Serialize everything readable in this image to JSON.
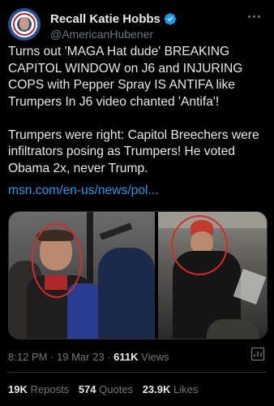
{
  "account": {
    "display_name": "Recall Katie Hobbs",
    "handle": "@AmericanHubener",
    "verified": true,
    "verified_color": "#1d9bf0"
  },
  "tweet": {
    "text": "Turns out 'MAGA Hat dude' BREAKING CAPITOL WINDOW on J6 and INJURING COPS with Pepper Spray IS ANTIFA like Trumpers In J6 video chanted 'Antifa'!\n\nTrumpers were right: Capitol Breechers were infiltrators posing as Trumpers! He voted Obama 2x, never Trump.",
    "link": "msn.com/en-us/news/pol...",
    "link_color": "#1d9bf0"
  },
  "media": {
    "photo_count": 2,
    "highlight_color": "#d62b2b"
  },
  "meta": {
    "time": "8:12 PM",
    "date": "19 Mar 23",
    "separator": "·",
    "views_count": "611K",
    "views_label": "Views"
  },
  "stats": {
    "reposts_count": "19K",
    "reposts_label": "Reposts",
    "quotes_count": "574",
    "quotes_label": "Quotes",
    "likes_count": "23.9K",
    "likes_label": "Likes"
  },
  "icons": {
    "verified": "verified-badge-icon",
    "more": "more-options-icon",
    "analytics": "analytics-icon"
  }
}
